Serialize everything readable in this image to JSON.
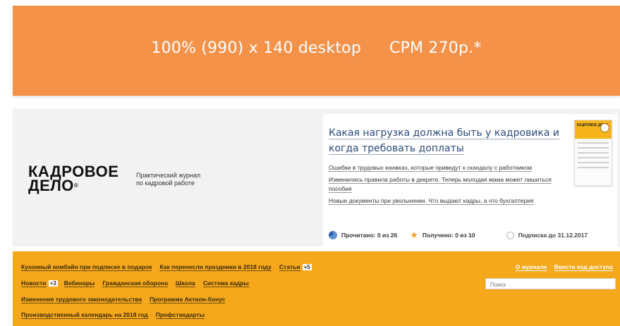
{
  "banner": {
    "size_label": "100% (990) x 140 desktop",
    "cpm_label": "CPM 270р.*",
    "color": "#f4924a"
  },
  "header": {
    "logo_line1": "КАДРОВОЕ",
    "logo_line2": "ДЕЛО",
    "logo_mark": "®",
    "tagline_line1": "Практический журнал",
    "tagline_line2": "по кадровой работе"
  },
  "feature": {
    "title": "Какая нагрузка должна быть у кадровика и когда требовать доплаты",
    "links": [
      "Ошибки в трудовых книжках, которые приведут к скандалу с работником",
      "Изменились правила работы в декрете. Теперь молодая мама может лишиться пособия",
      "Новые документы при увольнении. Что выдают кадры, а что бухгалтерия"
    ],
    "cover_logo": "КАДРОВОЕ ДЕЛО"
  },
  "stats": {
    "read_label": "Прочитано:",
    "read_value": "0 из 26",
    "received_label": "Получено:",
    "received_value": "0 из 10",
    "subscription": "Подписка до 31.12.2017"
  },
  "nav": {
    "row1": [
      "Кухонный комбайн при подписке в подарок",
      "Как перенесли праздники в 2018 году"
    ],
    "articles_label": "Статьи",
    "articles_badge": "+5",
    "news_label": "Новости",
    "news_badge": "+3",
    "row2": [
      "Вебинары",
      "Гражданская оборона",
      "Школа",
      "Система кадры"
    ],
    "row3": [
      "Изменения трудового законодательства",
      "Программа Актион-бонус"
    ],
    "row4": [
      "Производственный календарь на 2018 год",
      "Профстандарты"
    ],
    "right_links": [
      "О журнале",
      "Ввести код доступа"
    ],
    "search_placeholder": "Поиск",
    "color": "#f6a81c"
  }
}
